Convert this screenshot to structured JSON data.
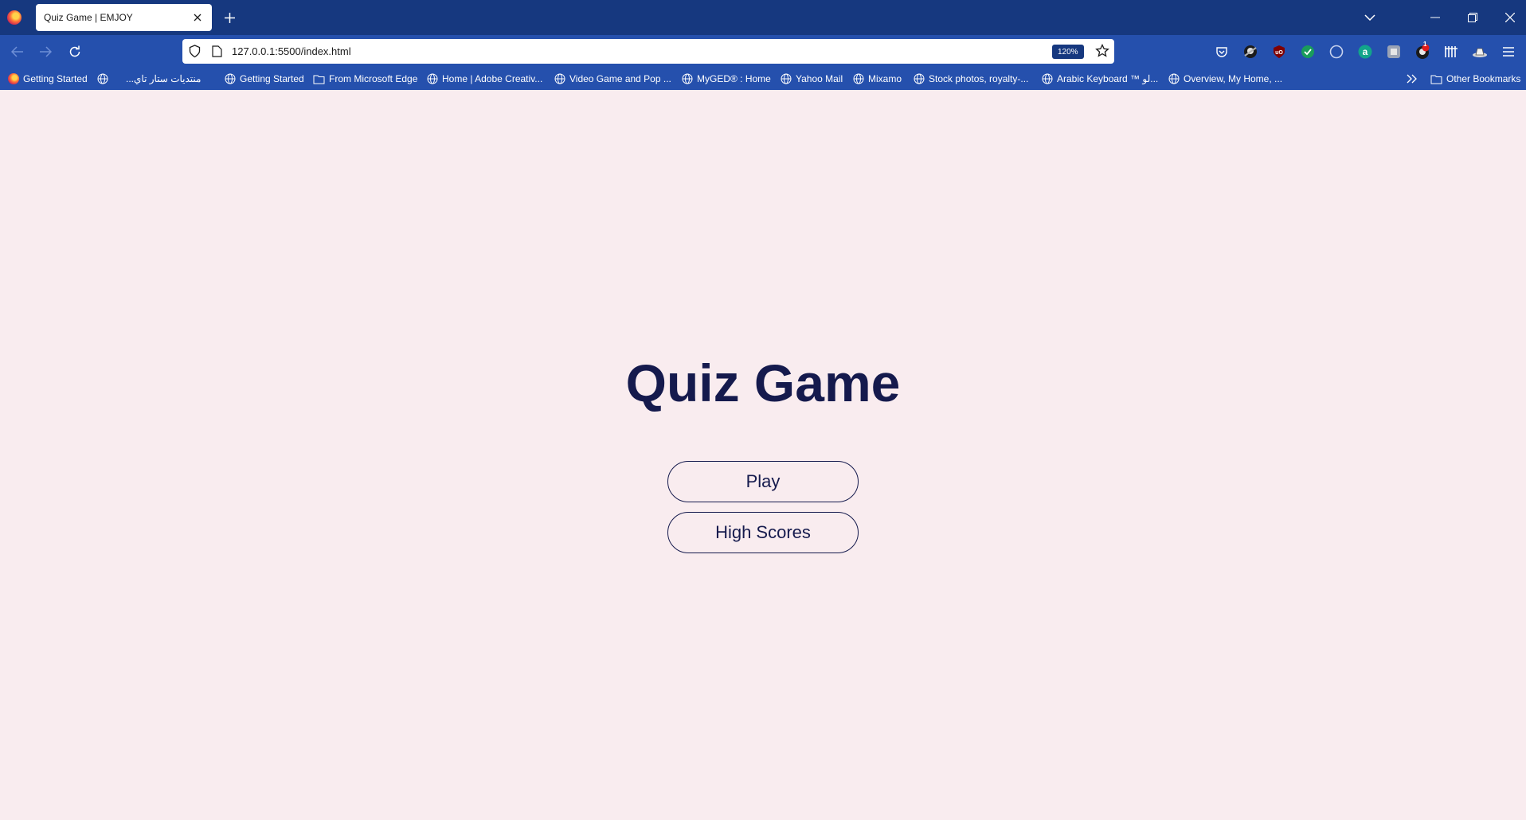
{
  "browser": {
    "tab_title": "Quiz Game | EMJOY",
    "url": "127.0.0.1:5500/index.html",
    "zoom": "120%",
    "notification_count": "1",
    "bookmarks": [
      "Getting Started",
      "...منتديات ستار تاي",
      "Getting Started",
      "From Microsoft Edge",
      "Home | Adobe Creativ...",
      "Video Game and Pop ...",
      "MyGED® : Home",
      "Yahoo Mail",
      "Mixamo",
      "Stock photos, royalty-...",
      "Arabic Keyboard ™ لو...",
      "Overview, My Home, ..."
    ],
    "other_bookmarks": "Other Bookmarks"
  },
  "page": {
    "title": "Quiz Game",
    "play_label": "Play",
    "high_scores_label": "High Scores"
  },
  "colors": {
    "background": "#f9ecef",
    "primary": "#151a4d",
    "browser_chrome": "#2550ad",
    "tab_strip": "#16387f"
  }
}
